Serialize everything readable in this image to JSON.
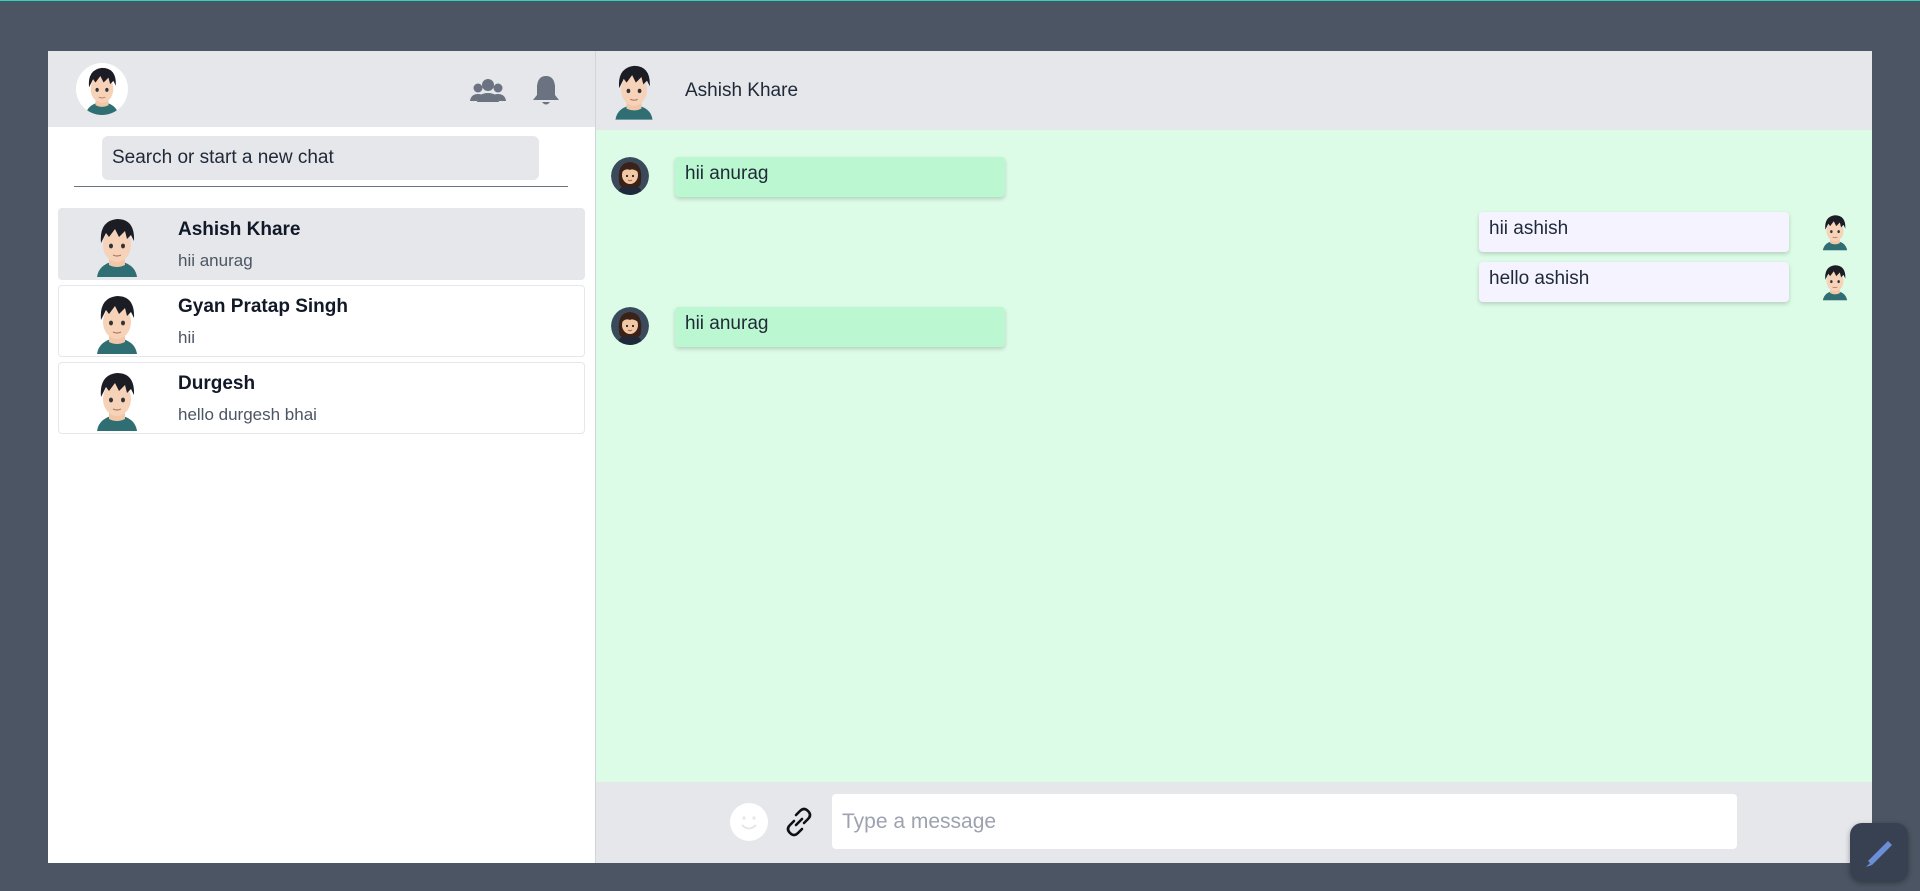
{
  "sidebar": {
    "my_avatar": "boy-avatar",
    "icons": {
      "group": "group-icon",
      "notifications": "bell-icon"
    },
    "search": {
      "placeholder": "Search or start a new chat"
    },
    "chats": [
      {
        "name": "Ashish Khare",
        "last_message": "hii anurag",
        "active": true
      },
      {
        "name": "Gyan Pratap Singh",
        "last_message": "hii",
        "active": false
      },
      {
        "name": "Durgesh",
        "last_message": "hello durgesh bhai",
        "active": false
      }
    ]
  },
  "chat": {
    "header": {
      "name": "Ashish Khare"
    },
    "messages": [
      {
        "text": "hii anurag",
        "direction": "incoming"
      },
      {
        "text": "hii ashish",
        "direction": "outgoing"
      },
      {
        "text": "hello ashish",
        "direction": "outgoing"
      },
      {
        "text": "hii anurag",
        "direction": "incoming"
      }
    ],
    "composer": {
      "placeholder": "Type a message",
      "emoji_icon": "smiley-icon",
      "attach_icon": "link-icon"
    }
  },
  "colors": {
    "page_bg": "#4b5563",
    "header_bg": "#e5e7eb",
    "chat_bg": "#dcfce7",
    "incoming_bubble": "#bbf7d0",
    "outgoing_bubble": "#f5f3ff"
  }
}
